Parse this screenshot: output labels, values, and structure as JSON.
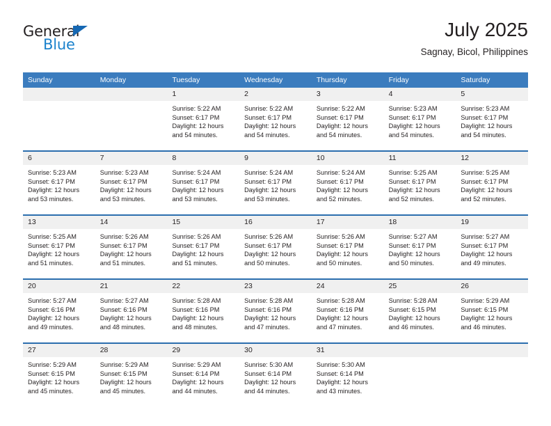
{
  "brand": {
    "name_top": "General",
    "name_bottom": "Blue",
    "accent_color": "#1b82cc",
    "triangle_color": "#1668b3"
  },
  "header": {
    "title": "July 2025",
    "subtitle": "Sagnay, Bicol, Philippines"
  },
  "colors": {
    "header_row_bg": "#3b7cbe",
    "week_separator": "#2b6eae",
    "daynum_band_bg": "#f0f0f0",
    "text": "#231f20",
    "page_bg": "#ffffff"
  },
  "weekdays": [
    "Sunday",
    "Monday",
    "Tuesday",
    "Wednesday",
    "Thursday",
    "Friday",
    "Saturday"
  ],
  "weeks": [
    {
      "days": [
        {
          "num": "",
          "lines": []
        },
        {
          "num": "",
          "lines": []
        },
        {
          "num": "1",
          "lines": [
            "Sunrise: 5:22 AM",
            "Sunset: 6:17 PM",
            "Daylight: 12 hours",
            "and 54 minutes."
          ]
        },
        {
          "num": "2",
          "lines": [
            "Sunrise: 5:22 AM",
            "Sunset: 6:17 PM",
            "Daylight: 12 hours",
            "and 54 minutes."
          ]
        },
        {
          "num": "3",
          "lines": [
            "Sunrise: 5:22 AM",
            "Sunset: 6:17 PM",
            "Daylight: 12 hours",
            "and 54 minutes."
          ]
        },
        {
          "num": "4",
          "lines": [
            "Sunrise: 5:23 AM",
            "Sunset: 6:17 PM",
            "Daylight: 12 hours",
            "and 54 minutes."
          ]
        },
        {
          "num": "5",
          "lines": [
            "Sunrise: 5:23 AM",
            "Sunset: 6:17 PM",
            "Daylight: 12 hours",
            "and 54 minutes."
          ]
        }
      ]
    },
    {
      "days": [
        {
          "num": "6",
          "lines": [
            "Sunrise: 5:23 AM",
            "Sunset: 6:17 PM",
            "Daylight: 12 hours",
            "and 53 minutes."
          ]
        },
        {
          "num": "7",
          "lines": [
            "Sunrise: 5:23 AM",
            "Sunset: 6:17 PM",
            "Daylight: 12 hours",
            "and 53 minutes."
          ]
        },
        {
          "num": "8",
          "lines": [
            "Sunrise: 5:24 AM",
            "Sunset: 6:17 PM",
            "Daylight: 12 hours",
            "and 53 minutes."
          ]
        },
        {
          "num": "9",
          "lines": [
            "Sunrise: 5:24 AM",
            "Sunset: 6:17 PM",
            "Daylight: 12 hours",
            "and 53 minutes."
          ]
        },
        {
          "num": "10",
          "lines": [
            "Sunrise: 5:24 AM",
            "Sunset: 6:17 PM",
            "Daylight: 12 hours",
            "and 52 minutes."
          ]
        },
        {
          "num": "11",
          "lines": [
            "Sunrise: 5:25 AM",
            "Sunset: 6:17 PM",
            "Daylight: 12 hours",
            "and 52 minutes."
          ]
        },
        {
          "num": "12",
          "lines": [
            "Sunrise: 5:25 AM",
            "Sunset: 6:17 PM",
            "Daylight: 12 hours",
            "and 52 minutes."
          ]
        }
      ]
    },
    {
      "days": [
        {
          "num": "13",
          "lines": [
            "Sunrise: 5:25 AM",
            "Sunset: 6:17 PM",
            "Daylight: 12 hours",
            "and 51 minutes."
          ]
        },
        {
          "num": "14",
          "lines": [
            "Sunrise: 5:26 AM",
            "Sunset: 6:17 PM",
            "Daylight: 12 hours",
            "and 51 minutes."
          ]
        },
        {
          "num": "15",
          "lines": [
            "Sunrise: 5:26 AM",
            "Sunset: 6:17 PM",
            "Daylight: 12 hours",
            "and 51 minutes."
          ]
        },
        {
          "num": "16",
          "lines": [
            "Sunrise: 5:26 AM",
            "Sunset: 6:17 PM",
            "Daylight: 12 hours",
            "and 50 minutes."
          ]
        },
        {
          "num": "17",
          "lines": [
            "Sunrise: 5:26 AM",
            "Sunset: 6:17 PM",
            "Daylight: 12 hours",
            "and 50 minutes."
          ]
        },
        {
          "num": "18",
          "lines": [
            "Sunrise: 5:27 AM",
            "Sunset: 6:17 PM",
            "Daylight: 12 hours",
            "and 50 minutes."
          ]
        },
        {
          "num": "19",
          "lines": [
            "Sunrise: 5:27 AM",
            "Sunset: 6:17 PM",
            "Daylight: 12 hours",
            "and 49 minutes."
          ]
        }
      ]
    },
    {
      "days": [
        {
          "num": "20",
          "lines": [
            "Sunrise: 5:27 AM",
            "Sunset: 6:16 PM",
            "Daylight: 12 hours",
            "and 49 minutes."
          ]
        },
        {
          "num": "21",
          "lines": [
            "Sunrise: 5:27 AM",
            "Sunset: 6:16 PM",
            "Daylight: 12 hours",
            "and 48 minutes."
          ]
        },
        {
          "num": "22",
          "lines": [
            "Sunrise: 5:28 AM",
            "Sunset: 6:16 PM",
            "Daylight: 12 hours",
            "and 48 minutes."
          ]
        },
        {
          "num": "23",
          "lines": [
            "Sunrise: 5:28 AM",
            "Sunset: 6:16 PM",
            "Daylight: 12 hours",
            "and 47 minutes."
          ]
        },
        {
          "num": "24",
          "lines": [
            "Sunrise: 5:28 AM",
            "Sunset: 6:16 PM",
            "Daylight: 12 hours",
            "and 47 minutes."
          ]
        },
        {
          "num": "25",
          "lines": [
            "Sunrise: 5:28 AM",
            "Sunset: 6:15 PM",
            "Daylight: 12 hours",
            "and 46 minutes."
          ]
        },
        {
          "num": "26",
          "lines": [
            "Sunrise: 5:29 AM",
            "Sunset: 6:15 PM",
            "Daylight: 12 hours",
            "and 46 minutes."
          ]
        }
      ]
    },
    {
      "days": [
        {
          "num": "27",
          "lines": [
            "Sunrise: 5:29 AM",
            "Sunset: 6:15 PM",
            "Daylight: 12 hours",
            "and 45 minutes."
          ]
        },
        {
          "num": "28",
          "lines": [
            "Sunrise: 5:29 AM",
            "Sunset: 6:15 PM",
            "Daylight: 12 hours",
            "and 45 minutes."
          ]
        },
        {
          "num": "29",
          "lines": [
            "Sunrise: 5:29 AM",
            "Sunset: 6:14 PM",
            "Daylight: 12 hours",
            "and 44 minutes."
          ]
        },
        {
          "num": "30",
          "lines": [
            "Sunrise: 5:30 AM",
            "Sunset: 6:14 PM",
            "Daylight: 12 hours",
            "and 44 minutes."
          ]
        },
        {
          "num": "31",
          "lines": [
            "Sunrise: 5:30 AM",
            "Sunset: 6:14 PM",
            "Daylight: 12 hours",
            "and 43 minutes."
          ]
        },
        {
          "num": "",
          "lines": []
        },
        {
          "num": "",
          "lines": []
        }
      ]
    }
  ]
}
